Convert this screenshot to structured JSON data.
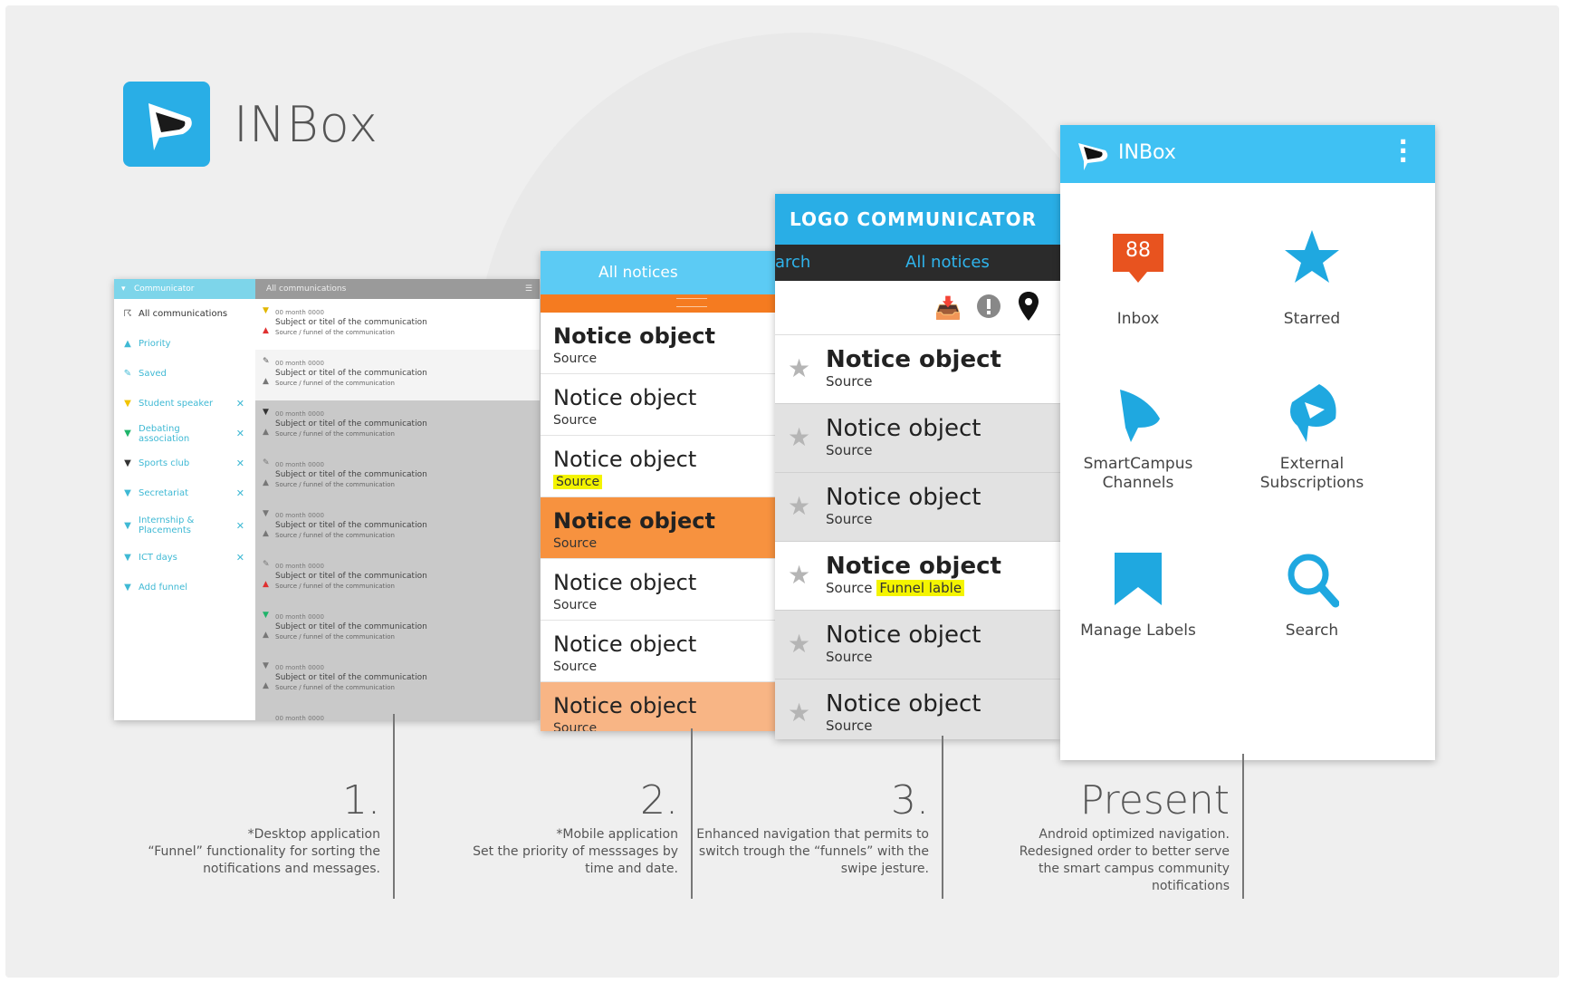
{
  "brand": {
    "title": "INBox"
  },
  "desktop": {
    "sidebar_header": "Communicator",
    "main_header": "All communications",
    "sidebar_items": [
      {
        "label": "All communications",
        "icon": "rss-icon"
      },
      {
        "label": "Priority",
        "icon": "warning-icon"
      },
      {
        "label": "Saved",
        "icon": "pin-icon"
      },
      {
        "label": "Student speaker",
        "icon": "funnel-icon",
        "removable": true
      },
      {
        "label": "Debating association",
        "icon": "funnel-icon",
        "removable": true
      },
      {
        "label": "Sports club",
        "icon": "funnel-icon",
        "removable": true
      },
      {
        "label": "Secretariat",
        "icon": "funnel-icon",
        "removable": true
      },
      {
        "label": "Internship & Placements",
        "icon": "funnel-icon",
        "removable": true
      },
      {
        "label": "ICT days",
        "icon": "funnel-icon",
        "removable": true
      },
      {
        "label": "Add funnel",
        "icon": "funnel-icon"
      }
    ],
    "row_date": "00 month 0000",
    "row_subject": "Subject or titel of the communication",
    "row_source": "Source / funnel of the communication",
    "last_row_date": "00 month 0000"
  },
  "mobile": {
    "header": "All notices",
    "items": [
      {
        "title": "Notice object",
        "source": "Source"
      },
      {
        "title": "Notice object",
        "source": "Source"
      },
      {
        "title": "Notice object",
        "source": "Source"
      },
      {
        "title": "Notice object",
        "source": "Source"
      },
      {
        "title": "Notice object",
        "source": "Source"
      },
      {
        "title": "Notice object",
        "source": "Source"
      },
      {
        "title": "Notice object",
        "source": "Source"
      }
    ]
  },
  "communicator": {
    "header": "LOGO COMMUNICATOR",
    "tab_prev": "arch",
    "tab_active": "All notices",
    "funnel_label": "Funnel lable",
    "items": [
      {
        "title": "Notice object",
        "source": "Source"
      },
      {
        "title": "Notice object",
        "source": "Source"
      },
      {
        "title": "Notice object",
        "source": "Source"
      },
      {
        "title": "Notice object",
        "source": "Source"
      },
      {
        "title": "Notice object",
        "source": "Source"
      },
      {
        "title": "Notice object",
        "source": "Source"
      }
    ]
  },
  "present_app": {
    "title": "INBox",
    "inbox_count": "88",
    "tiles": [
      {
        "label": "Inbox"
      },
      {
        "label": "Starred"
      },
      {
        "label": "SmartCampus Channels"
      },
      {
        "label": "External Subscriptions"
      },
      {
        "label": "Manage Labels"
      },
      {
        "label": "Search"
      }
    ]
  },
  "captions": [
    {
      "num": "1.",
      "lines": [
        "*Desktop application",
        "“Funnel” functionality for sorting the",
        "notifications and messages."
      ]
    },
    {
      "num": "2.",
      "lines": [
        "*Mobile application",
        "Set the priority of messsages by",
        "time and date."
      ]
    },
    {
      "num": "3.",
      "lines": [
        "Enhanced navigation that permits to",
        "switch trough the  “funnels” with the",
        "swipe jesture."
      ]
    },
    {
      "num": "Present",
      "lines": [
        "Android optimized  navigation.",
        "Redesigned  order to better serve",
        "the smart campus community",
        "notifications"
      ]
    }
  ],
  "colors": {
    "accent_blue": "#29aee6",
    "light_blue": "#5ccbf4",
    "orange": "#f57b20",
    "highlight": "#f4f400",
    "inbox_badge": "#e8531f"
  }
}
